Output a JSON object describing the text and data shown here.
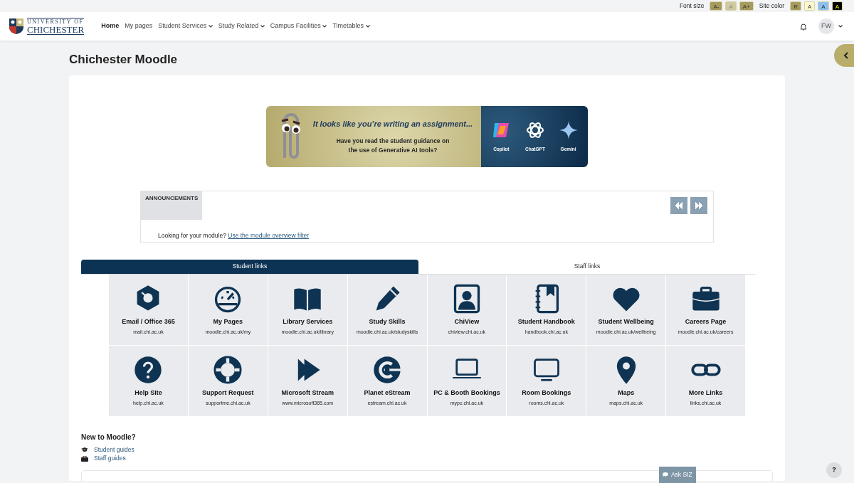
{
  "top_bar": {
    "font_size_label": "Font size",
    "font_size_buttons": [
      {
        "label": "A-",
        "disabled": false
      },
      {
        "label": "A",
        "disabled": true
      },
      {
        "label": "A+",
        "disabled": false
      }
    ],
    "site_color_label": "Site color",
    "site_color_buttons": [
      {
        "label": "R",
        "color": "#a69b5e"
      },
      {
        "label": "A",
        "color": "#fffacd"
      },
      {
        "label": "A",
        "color": "#8cc0f0"
      },
      {
        "label": "A",
        "color": "#000000"
      }
    ]
  },
  "logo": {
    "line_1": "UNIVERSITY OF",
    "line_2": "CHICHESTER"
  },
  "nav": [
    {
      "label": "Home",
      "selected": true,
      "dropdown": false
    },
    {
      "label": "My pages",
      "selected": false,
      "dropdown": false
    },
    {
      "label": "Student Services",
      "selected": false,
      "dropdown": true
    },
    {
      "label": "Study Related",
      "selected": false,
      "dropdown": true
    },
    {
      "label": "Campus Facilities",
      "selected": false,
      "dropdown": true
    },
    {
      "label": "Timetables",
      "selected": false,
      "dropdown": true
    }
  ],
  "user": {
    "initials": "FW"
  },
  "page_title": "Chichester Moodle",
  "banner": {
    "headline": "It looks like you’re writing an assignment...",
    "question": "Have you read the student guidance on the use of **Generative AI tools**?",
    "tools": [
      "Copilot",
      "ChatGPT",
      "Gemini"
    ]
  },
  "announcements": {
    "label": "ANNOUNCEMENTS",
    "text": "Looking for your module? ",
    "link": "Use the module overview filter"
  },
  "link_tabs": [
    {
      "label": "Student links",
      "selected": true
    },
    {
      "label": "Staff links",
      "selected": false
    }
  ],
  "tiles": [
    {
      "title": "Email / Office 365",
      "url": "mail.chi.ac.uk"
    },
    {
      "title": "My Pages",
      "url": "moodle.chi.ac.uk/my"
    },
    {
      "title": "Library Services",
      "url": "moodle.chi.ac.uk/library"
    },
    {
      "title": "Study Skills",
      "url": "moodle.chi.ac.uk/studyskills"
    },
    {
      "title": "ChiView",
      "url": "chiview.chi.ac.uk"
    },
    {
      "title": "Student Handbook",
      "url": "handbook.chi.ac.uk"
    },
    {
      "title": "Student Wellbeing",
      "url": "moodle.chi.ac.uk/wellbeing"
    },
    {
      "title": "Careers Page",
      "url": "moodle.chi.ac.uk/careers"
    },
    {
      "title": "Help Site",
      "url": "help.chi.ac.uk"
    },
    {
      "title": "Support Request",
      "url": "supportme.chi.ac.uk"
    },
    {
      "title": "Microsoft Stream",
      "url": "www.microsoft365.com"
    },
    {
      "title": "Planet eStream",
      "url": "estream.chi.ac.uk"
    },
    {
      "title": "PC & Booth Bookings",
      "url": "mypc.chi.ac.uk"
    },
    {
      "title": "Room Bookings",
      "url": "rooms.chi.ac.uk"
    },
    {
      "title": "Maps",
      "url": "maps.chi.ac.uk"
    },
    {
      "title": "More Links",
      "url": "links.chi.ac.uk"
    }
  ],
  "new_to_moodle": {
    "heading": "New to Moodle?",
    "links": [
      "Student guides",
      "Staff guides"
    ]
  },
  "ask_button": "Ask SIZ",
  "help_button": "?"
}
